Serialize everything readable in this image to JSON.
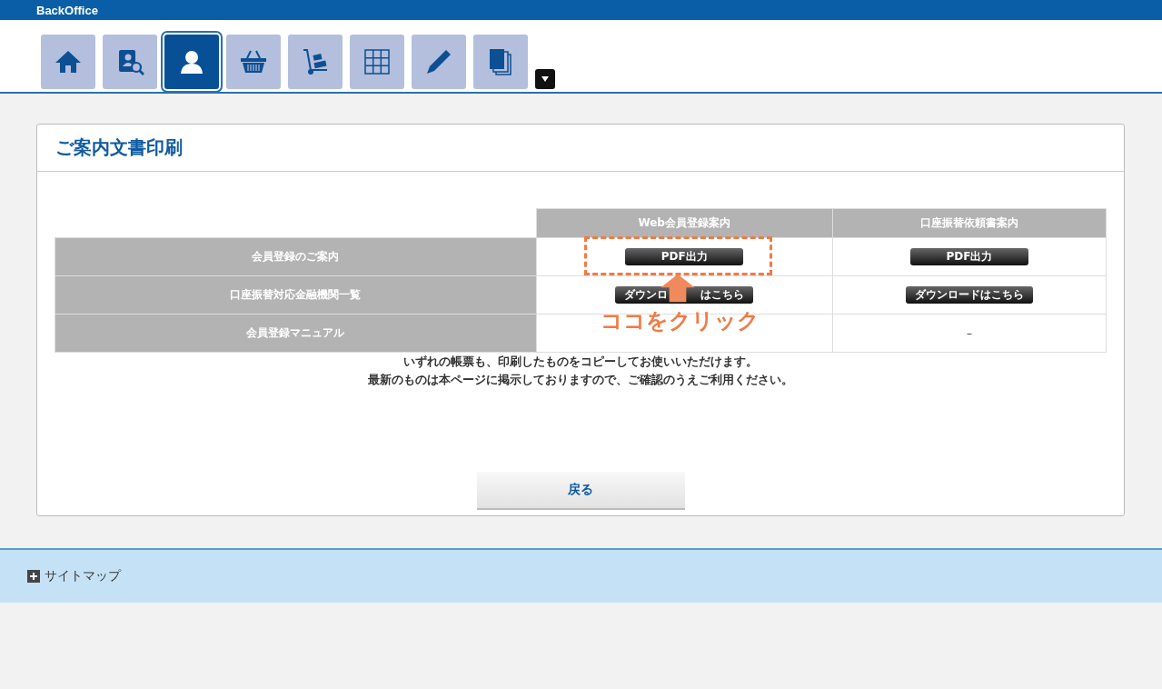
{
  "header": {
    "brand": "BackOffice"
  },
  "tabs": [
    {
      "selected": false
    },
    {
      "selected": false
    },
    {
      "selected": true
    },
    {
      "selected": false
    },
    {
      "selected": false
    },
    {
      "selected": false
    },
    {
      "selected": false
    },
    {
      "selected": false
    }
  ],
  "panel": {
    "title": "ご案内文書印刷",
    "table": {
      "columns": [
        "Web会員登録案内",
        "口座振替依頼書案内"
      ],
      "rows": [
        {
          "label": "会員登録のご案内",
          "cells": [
            {
              "kind": "button",
              "text": "PDF出力"
            },
            {
              "kind": "button",
              "text": "PDF出力"
            }
          ]
        },
        {
          "label": "口座振替対応金融機関一覧",
          "cells": [
            {
              "kind": "button",
              "text": "ダウンロ　　　はこちら"
            },
            {
              "kind": "button",
              "text": "ダウンロードはこちら"
            }
          ]
        },
        {
          "label": "会員登録マニュアル",
          "cells": [
            {
              "kind": "covered"
            },
            {
              "kind": "text",
              "text": "–"
            }
          ]
        }
      ]
    },
    "notes": [
      "いずれの帳票も、印刷したものをコピーしてお使いいただけます。",
      "最新のものは本ページに掲示しておりますので、ご確認のうえご利用ください。"
    ],
    "back_button": "戻る"
  },
  "callout": {
    "text": "ココをクリック"
  },
  "footer": {
    "sitemap": "サイトマップ"
  }
}
